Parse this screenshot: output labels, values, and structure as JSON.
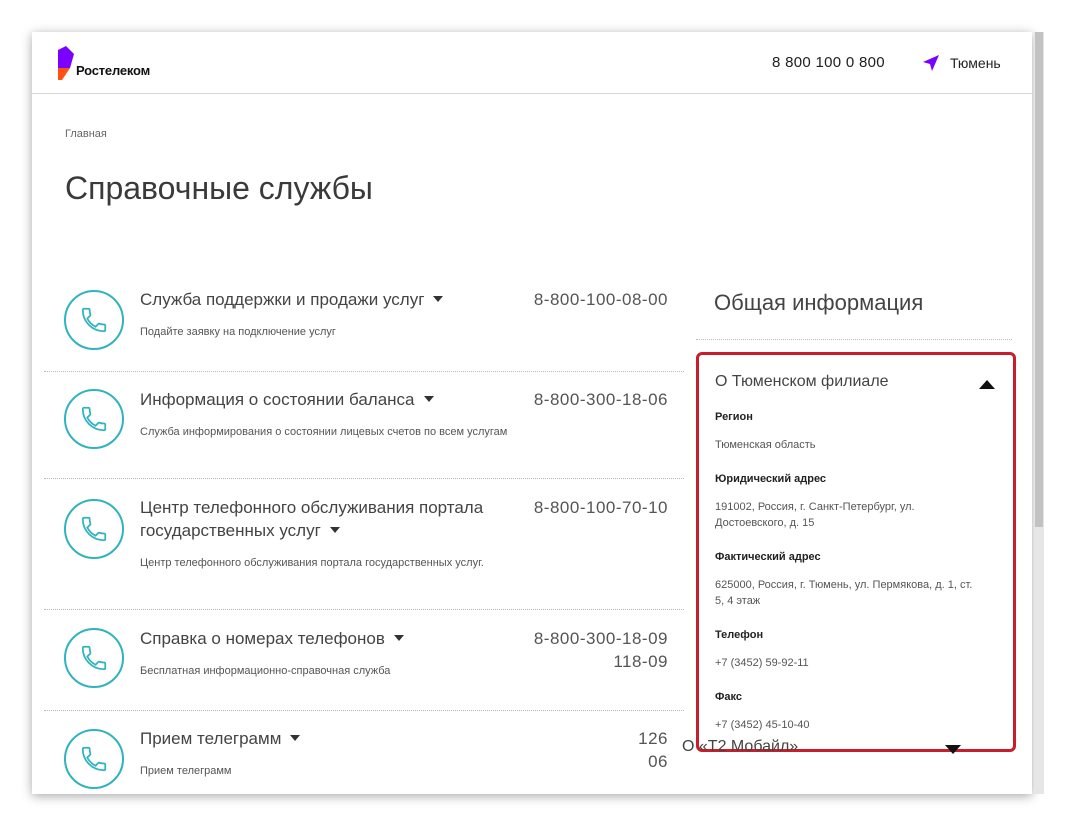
{
  "header": {
    "logo_text": "Ростелеком",
    "phone": "8 800 100 0 800",
    "city": "Тюмень",
    "brand_color": "#7700ff"
  },
  "breadcrumb": "Главная",
  "page_title": "Справочные службы",
  "services": [
    {
      "title": "Служба поддержки и продажи услуг",
      "desc": "Подайте заявку на подключение услуг",
      "numbers": [
        "8-800-100-08-00"
      ]
    },
    {
      "title": "Информация о состоянии баланса",
      "desc": "Служба информирования о состоянии лицевых счетов по всем услугам",
      "numbers": [
        "8-800-300-18-06"
      ]
    },
    {
      "title": "Центр телефонного обслуживания портала государственных услуг",
      "desc": "Центр телефонного обслуживания портала государственных услуг.",
      "numbers": [
        "8-800-100-70-10"
      ]
    },
    {
      "title": "Справка о номерах телефонов",
      "desc": "Бесплатная информационно-справочная служба",
      "numbers": [
        "8-800-300-18-09",
        "118-09"
      ]
    },
    {
      "title": "Прием телеграмм",
      "desc": "Прием телеграмм",
      "numbers": [
        "126",
        "06"
      ]
    }
  ],
  "info": {
    "heading": "Общая информация",
    "branch_title": "О Тюменском филиале",
    "fields": [
      {
        "label": "Регион",
        "value": "Тюменская область"
      },
      {
        "label": "Юридический адрес",
        "value": "191002, Россия, г. Санкт-Петербург, ул. Достоевского, д. 15"
      },
      {
        "label": "Фактический адрес",
        "value": "625000, Россия, г. Тюмень, ул. Пермякова, д. 1, ст. 5, 4 этаж"
      },
      {
        "label": "Телефон",
        "value": "+7 (3452) 59-92-11"
      },
      {
        "label": "Факс",
        "value": "+7 (3452) 45-10-40"
      }
    ],
    "next_section": "О «Т2 Мобайл»",
    "highlight_color": "#c81e2c"
  },
  "icons": {
    "logo": "rostelecom-logo-icon",
    "location": "location-arrow-icon",
    "service": "phone-handset-icon"
  }
}
